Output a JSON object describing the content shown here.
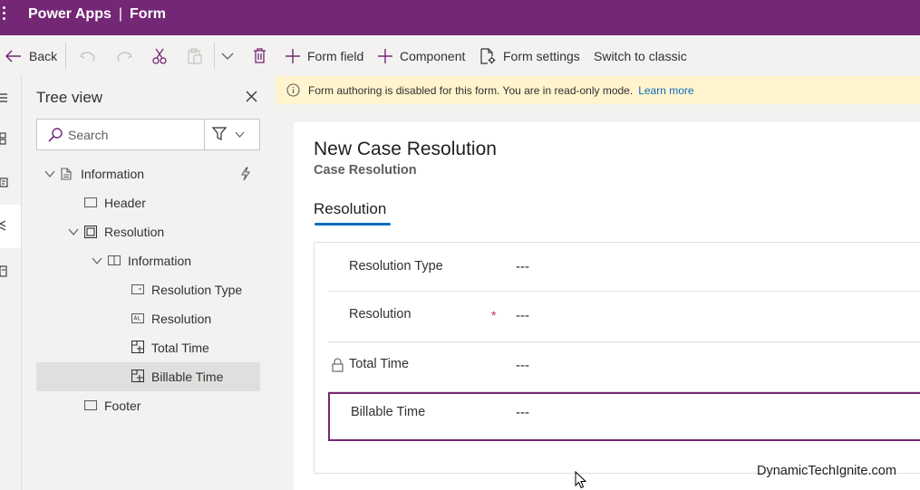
{
  "app": {
    "product": "Power Apps",
    "separator": "|",
    "page": "Form"
  },
  "toolbar": {
    "back": "Back",
    "form_field": "Form field",
    "component": "Component",
    "form_settings": "Form settings",
    "switch_classic": "Switch to classic"
  },
  "tree": {
    "title": "Tree view",
    "search_placeholder": "Search",
    "nodes": [
      {
        "label": "Information"
      },
      {
        "label": "Header"
      },
      {
        "label": "Resolution"
      },
      {
        "label": "Information"
      },
      {
        "label": "Resolution Type"
      },
      {
        "label": "Resolution"
      },
      {
        "label": "Total Time"
      },
      {
        "label": "Billable Time"
      },
      {
        "label": "Footer"
      }
    ]
  },
  "banner": {
    "text": "Form authoring is disabled for this form. You are in read-only mode.",
    "link": "Learn more"
  },
  "form": {
    "title": "New Case Resolution",
    "subtitle": "Case Resolution",
    "tab": "Resolution",
    "fields": [
      {
        "label": "Resolution Type",
        "value": "---"
      },
      {
        "label": "Resolution",
        "value": "---",
        "required_mark": "*"
      },
      {
        "label": "Total Time",
        "value": "---"
      },
      {
        "label": "Billable Time",
        "value": "---"
      }
    ]
  },
  "watermark": "DynamicTechIgnite.com",
  "colors": {
    "brand": "#742774",
    "accent": "#0f6cbd",
    "banner": "#fff4ce",
    "required": "#c4314b"
  }
}
